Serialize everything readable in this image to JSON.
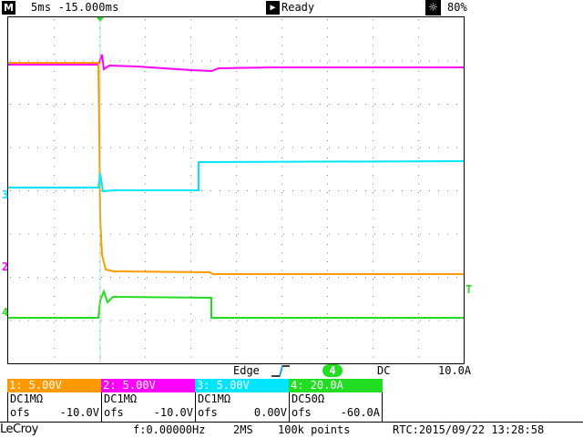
{
  "topbar": {
    "menu_icon": "M",
    "timebase": "5ms -15.000ms",
    "run_icon": "play-icon",
    "status": "Ready",
    "brightness_icon": "sun-icon",
    "brightness": "80%"
  },
  "markers": {
    "ch3": "3",
    "ch2": "2",
    "ch4": "4",
    "trigger": "T"
  },
  "trigger": {
    "mode": "Edge",
    "source": "4",
    "coupling": "DC",
    "level": "10.0A"
  },
  "channels": [
    {
      "header": "1: 5.00V",
      "coupling": "DC1MΩ",
      "ofs_label": "ofs",
      "ofs_value": "-10.0V",
      "color": "#ff9900"
    },
    {
      "header": "2: 5.00V",
      "coupling": "DC1MΩ",
      "ofs_label": "ofs",
      "ofs_value": "-10.0V",
      "color": "#ff00ff"
    },
    {
      "header": "3: 5.00V",
      "coupling": "DC1MΩ",
      "ofs_label": "ofs",
      "ofs_value": "0.00V",
      "color": "#00e5ff"
    },
    {
      "header": "4: 20.0A",
      "coupling": "DC50Ω",
      "ofs_label": "ofs",
      "ofs_value": "-60.0A",
      "color": "#22dd22"
    }
  ],
  "bottombar": {
    "logo": "LeCroy",
    "frequency": "f:0.00000Hz",
    "sample_rate": "2MS",
    "points": "100k points",
    "rtc": "RTC:2015/09/22 13:28:58"
  },
  "colors": {
    "ch1": "#ff9900",
    "ch2": "#ff00ff",
    "ch3": "#00e5ff",
    "ch4": "#22dd22",
    "grid": "#7a7a7a"
  }
}
